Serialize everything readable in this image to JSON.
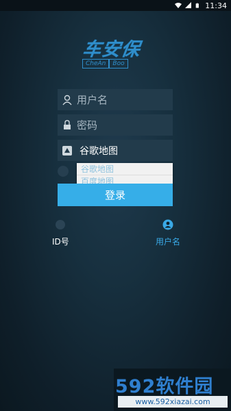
{
  "status_bar": {
    "time": "11:34",
    "icons": [
      "wifi-icon",
      "signal-icon",
      "battery-icon"
    ]
  },
  "logo": {
    "title": "车安保",
    "sub_left": "CheAn",
    "sub_right": "Boo"
  },
  "form": {
    "username_placeholder": "用户名",
    "password_placeholder": "密码",
    "map_provider_selected": "谷歌地图",
    "map_options": [
      "谷歌地图",
      "百度地图"
    ],
    "login_label": "登录"
  },
  "mode_switch": {
    "id_label": "ID号",
    "user_label": "用户名",
    "active": "user"
  },
  "watermark": {
    "digits": "592",
    "text": "软件园",
    "url": "www.592xiazai.com"
  },
  "colors": {
    "accent": "#36aee8",
    "logo": "#2f8ecb",
    "field_bg": "#223b4b"
  }
}
